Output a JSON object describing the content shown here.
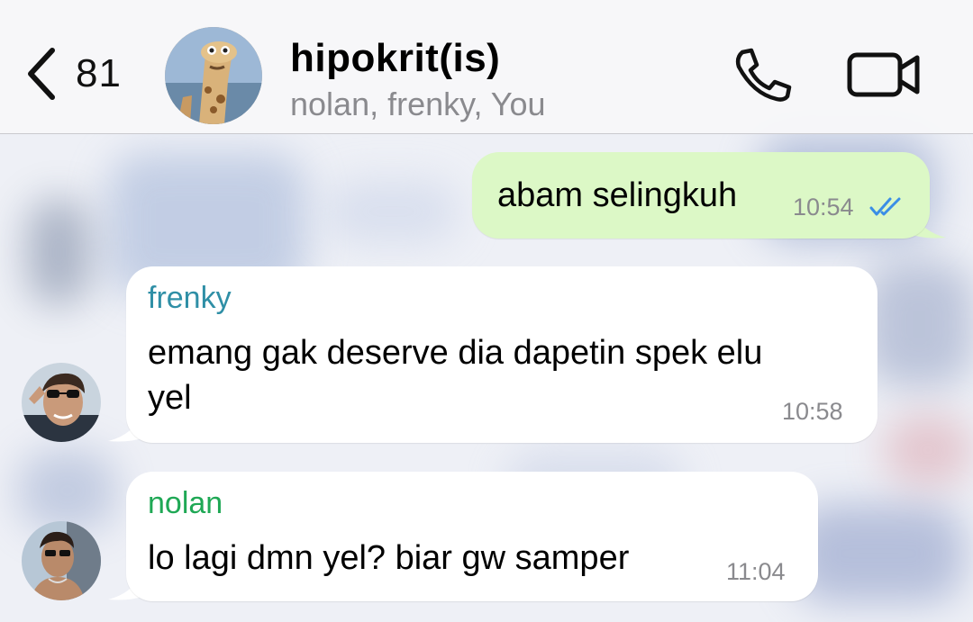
{
  "header": {
    "back_count": "81",
    "title": "hipokrit(is)",
    "subtitle": "nolan, frenky, You"
  },
  "messages": [
    {
      "direction": "outgoing",
      "text": "abam selingkuh",
      "time": "10:54",
      "status": "read"
    },
    {
      "direction": "incoming",
      "sender": "frenky",
      "sender_color": "#2f8fa6",
      "text_line1": "emang gak deserve dia dapetin spek elu",
      "text_line2": "yel",
      "time": "10:58"
    },
    {
      "direction": "incoming",
      "sender": "nolan",
      "sender_color": "#1fa855",
      "text": "lo lagi dmn yel? biar gw samper",
      "time": "11:04"
    }
  ],
  "colors": {
    "outgoing_bubble": "#dcf8c6",
    "incoming_bubble": "#ffffff",
    "read_ticks": "#3a8ee6"
  },
  "icons": [
    "chevron-left-icon",
    "phone-icon",
    "video-camera-icon",
    "double-check-icon"
  ]
}
